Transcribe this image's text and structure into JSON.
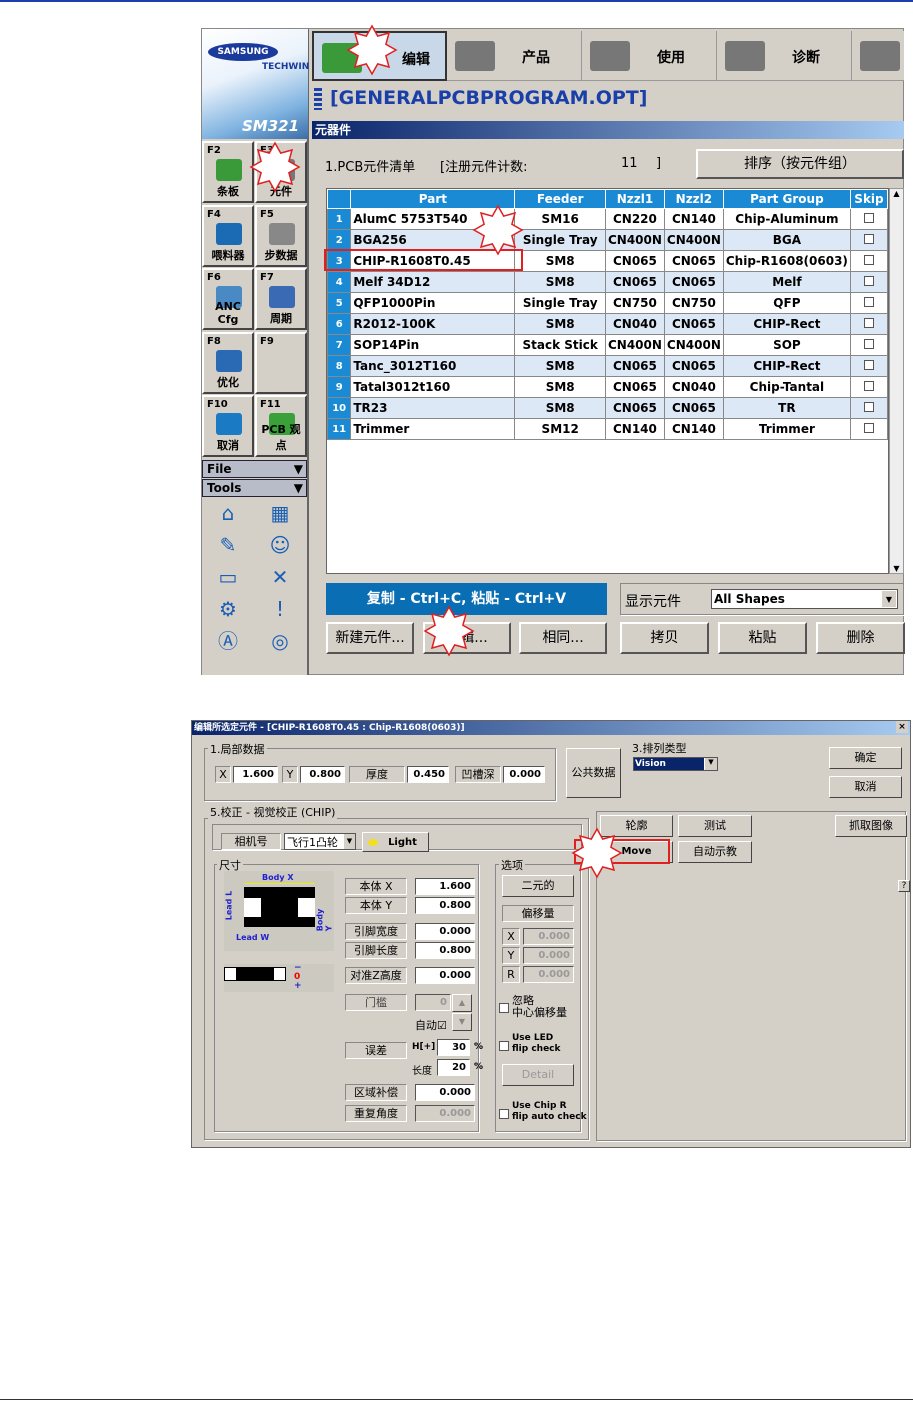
{
  "top": {
    "logo": {
      "brand": "SAMSUNG",
      "sub": "TECHWIN",
      "model": "SM321"
    },
    "toolbar": [
      {
        "label": "编辑"
      },
      {
        "label": "产品"
      },
      {
        "label": "使用"
      },
      {
        "label": "诊断"
      }
    ],
    "program_title": "[GENERALPCBPROGRAM.OPT]",
    "panel_title": "元器件",
    "list_label": "1.PCB元件清单",
    "count_label": "[注册元件计数:",
    "count_value": "11",
    "count_close": "]",
    "sort_button": "排序（按元件组）",
    "sidebar": [
      {
        "key": "F2",
        "label": "条板"
      },
      {
        "key": "F3",
        "label": "元件"
      },
      {
        "key": "F4",
        "label": "喂料器"
      },
      {
        "key": "F5",
        "label": "步数据"
      },
      {
        "key": "F6",
        "label": "ANC Cfg"
      },
      {
        "key": "F7",
        "label": "周期"
      },
      {
        "key": "F8",
        "label": "优化"
      },
      {
        "key": "F9",
        "label": ""
      },
      {
        "key": "F10",
        "label": "取消"
      },
      {
        "key": "F11",
        "label": "PCB 观点"
      }
    ],
    "file_menu": "File",
    "tools_menu": "Tools",
    "tool_icons": [
      "home-icon",
      "grid-target-icon",
      "nozzle-icon",
      "operator-icon",
      "pcb-conveyor-icon",
      "xyz-axis-icon",
      "feeder-icon",
      "warning-bin-icon",
      "auto-bin-icon",
      "camera-station-icon"
    ],
    "table": {
      "columns": [
        "",
        "Part",
        "Feeder",
        "Nzzl1",
        "Nzzl2",
        "Part Group",
        "Skip"
      ],
      "rows": [
        [
          "1",
          "AlumC 5753T540",
          "SM16",
          "CN220",
          "CN140",
          "Chip-Aluminum"
        ],
        [
          "2",
          "BGA256",
          "Single Tray",
          "CN400N",
          "CN400N",
          "BGA"
        ],
        [
          "3",
          "CHIP-R1608T0.45",
          "SM8",
          "CN065",
          "CN065",
          "Chip-R1608(0603)"
        ],
        [
          "4",
          "Melf 34D12",
          "SM8",
          "CN065",
          "CN065",
          "Melf"
        ],
        [
          "5",
          "QFP1000Pin",
          "Single Tray",
          "CN750",
          "CN750",
          "QFP"
        ],
        [
          "6",
          "R2012-100K",
          "SM8",
          "CN040",
          "CN065",
          "CHIP-Rect"
        ],
        [
          "7",
          "SOP14Pin",
          "Stack Stick",
          "CN400N",
          "CN400N",
          "SOP"
        ],
        [
          "8",
          "Tanc_3012T160",
          "SM8",
          "CN065",
          "CN065",
          "CHIP-Rect"
        ],
        [
          "9",
          "Tatal3012t160",
          "SM8",
          "CN065",
          "CN040",
          "Chip-Tantal"
        ],
        [
          "10",
          "TR23",
          "SM8",
          "CN065",
          "CN065",
          "TR"
        ],
        [
          "11",
          "Trimmer",
          "SM12",
          "CN140",
          "CN140",
          "Trimmer"
        ]
      ]
    },
    "copy_hint": "复制 - Ctrl+C, 粘贴 - Ctrl+V",
    "show_label": "显示元件",
    "show_value": "All Shapes",
    "buttons": [
      "新建元件...",
      "编辑...",
      "相同...",
      "拷贝",
      "粘贴",
      "删除"
    ]
  },
  "dialog": {
    "title": "编辑所选定元件 - [CHIP-R1608T0.45 : Chip-R1608(0603)]",
    "local_group": "1.局部数据",
    "x_label": "X",
    "x_value": "1.600",
    "y_label": "Y",
    "y_value": "0.800",
    "thick_label": "厚度",
    "thick_value": "0.450",
    "groove_label": "凹槽深",
    "groove_value": "0.000",
    "common_button": "公共数据",
    "align_type_label": "3.排列类型",
    "align_type_value": "Vision",
    "ok": "确定",
    "cancel": "取消",
    "contour": "轮廓",
    "test": "测试",
    "grab": "抓取图像",
    "move": "Move",
    "autoteach": "自动示教",
    "calib_group": "5.校正 - 视觉校正 (CHIP)",
    "camera_label": "相机号",
    "camera_value": "飞行1凸轮",
    "light": "Light",
    "size_group": "尺寸",
    "diagram": {
      "body_x": "Body X",
      "body_y": "Body Y",
      "lead_l": "Lead L",
      "lead_w": "Lead W",
      "minus": "−",
      "zero": "0",
      "plus": "+"
    },
    "fields": [
      {
        "label": "本体 X",
        "value": "1.600"
      },
      {
        "label": "本体 Y",
        "value": "0.800"
      },
      {
        "label": "引脚宽度",
        "value": "0.000"
      },
      {
        "label": "引脚长度",
        "value": "0.800"
      },
      {
        "label": "对准Z高度",
        "value": "0.000"
      }
    ],
    "threshold_label": "门槛",
    "threshold_value": "0",
    "auto_label": "自动☑",
    "tol_label": "误差",
    "tol_h_label": "H[+]",
    "tol_h_value": "30",
    "tol_l_label": "长度",
    "tol_l_value": "20",
    "pct": "%",
    "zone_label": "区域补偿",
    "zone_value": "0.000",
    "repeat_label": "重复角度",
    "repeat_value": "0.000",
    "options_group": "选项",
    "binary": "二元的",
    "offset_label": "偏移量",
    "offsets": [
      {
        "label": "X",
        "value": "0.000"
      },
      {
        "label": "Y",
        "value": "0.000"
      },
      {
        "label": "R",
        "value": "0.000"
      }
    ],
    "ignore_center": "忽略\n中心偏移量",
    "led_flip": "Use LED\nflip check",
    "detail": "Detail",
    "chip_flip": "Use Chip R\nflip auto check",
    "help": "?"
  }
}
